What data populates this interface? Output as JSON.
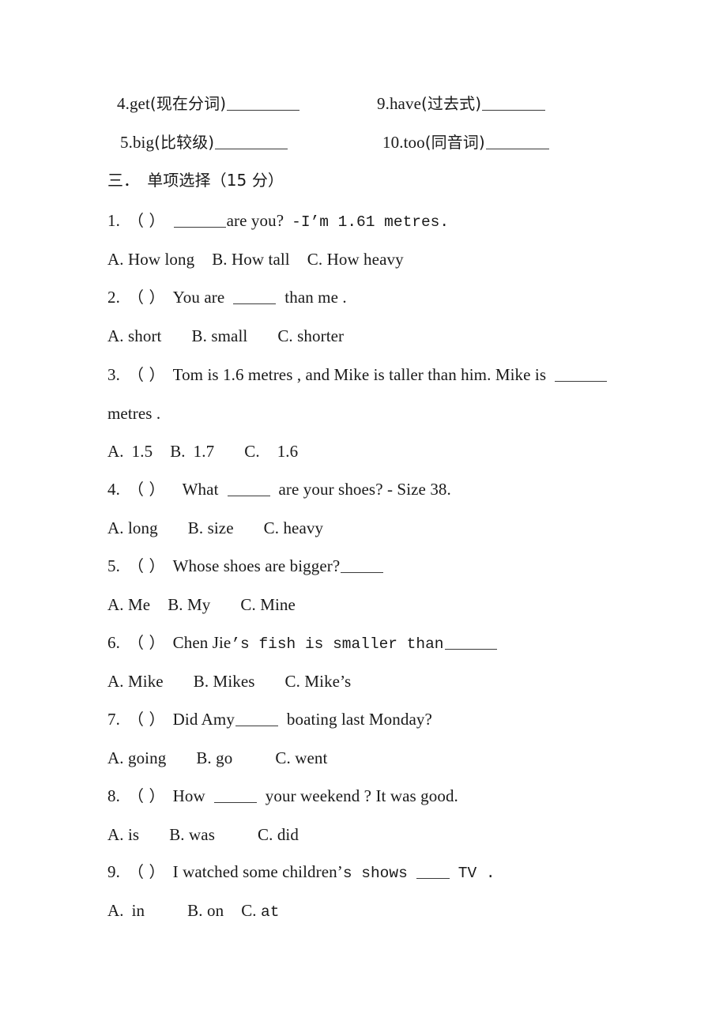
{
  "document": {
    "type": "exam-paper",
    "language": "zh-CN + en",
    "background_color": "#ffffff",
    "text_color": "#1a1a1a"
  },
  "word_form_items": {
    "left_column": [
      {
        "number": "4.",
        "word": "get",
        "hint": "(现在分词)",
        "answer_blank": true
      },
      {
        "number": "5.",
        "word": "big",
        "hint": "(比较级)",
        "answer_blank": true
      }
    ],
    "right_column": [
      {
        "number": "9.",
        "word": "have",
        "hint": "(过去式)",
        "answer_blank": true
      },
      {
        "number": "10.",
        "word": "too",
        "hint": "(同音词)",
        "answer_blank": true
      }
    ]
  },
  "section": {
    "label": "三．",
    "title": "单项选择",
    "points": "（15 分）"
  },
  "questions": [
    {
      "number": "1.",
      "marker": "（    ）",
      "stem_pre": "",
      "stem_post_serif": "are you?",
      "stem_mono": "-I’m  1.61  metres.",
      "options": [
        {
          "key": "A.",
          "text": "How long"
        },
        {
          "key": "B.",
          "text": "How tall"
        },
        {
          "key": "C.",
          "text": "How heavy"
        }
      ]
    },
    {
      "number": "2.",
      "marker": "（  ）",
      "stem_pre": "You are",
      "stem_post_serif": "than me .",
      "options": [
        {
          "key": "A.",
          "text": "short"
        },
        {
          "key": "B.",
          "text": "small"
        },
        {
          "key": "C.",
          "text": "shorter"
        }
      ]
    },
    {
      "number": "3.",
      "marker": "（   ）",
      "stem_pre": "Tom is 1.6 metres , and Mike is taller than him. Mike is",
      "stem_wrap": "metres .",
      "options": [
        {
          "key": "A.",
          "text": "1.5"
        },
        {
          "key": "B.",
          "text": "1.7"
        },
        {
          "key": "C.",
          "text": "1.6"
        }
      ]
    },
    {
      "number": "4.",
      "marker": "（  ）",
      "stem_pre": "What",
      "stem_post_serif": "are your shoes?   - Size 38.",
      "options": [
        {
          "key": "A.",
          "text": "long"
        },
        {
          "key": "B.",
          "text": "size"
        },
        {
          "key": "C.",
          "text": "heavy"
        }
      ]
    },
    {
      "number": "5.",
      "marker": "（  ）",
      "stem_pre": "Whose shoes are bigger?",
      "options": [
        {
          "key": "A.",
          "text": "Me"
        },
        {
          "key": "B.",
          "text": "My"
        },
        {
          "key": "C.",
          "text": "Mine"
        }
      ]
    },
    {
      "number": "6.",
      "marker": "（  ）",
      "stem_serif": "Chen Jie",
      "stem_mono": "’s fish is smaller than",
      "options": [
        {
          "key": "A.",
          "text": "Mike"
        },
        {
          "key": "B.",
          "text": "Mikes"
        },
        {
          "key": "C.",
          "text": "Mike’s"
        }
      ]
    },
    {
      "number": "7.",
      "marker": "（  ）",
      "stem_pre": "Did Amy",
      "stem_post_serif": "boating last Monday?",
      "options": [
        {
          "key": "A.",
          "text": "going"
        },
        {
          "key": "B.",
          "text": "go"
        },
        {
          "key": "C.",
          "text": "went"
        }
      ]
    },
    {
      "number": "8.",
      "marker": "（  ）",
      "stem_pre": "How",
      "stem_post_serif": "your weekend ? It was good.",
      "options": [
        {
          "key": "A.",
          "text": "is"
        },
        {
          "key": "B.",
          "text": "was"
        },
        {
          "key": "C.",
          "text": "did"
        }
      ]
    },
    {
      "number": "9.",
      "marker": "（  ）",
      "stem_serif": "I watched some children’",
      "stem_mono_a": "s  shows",
      "stem_mono_b": "TV .",
      "options": [
        {
          "key": "A.",
          "text": "in"
        },
        {
          "key": "B.",
          "text": "on"
        },
        {
          "key": "C.",
          "text": "at"
        }
      ]
    }
  ]
}
